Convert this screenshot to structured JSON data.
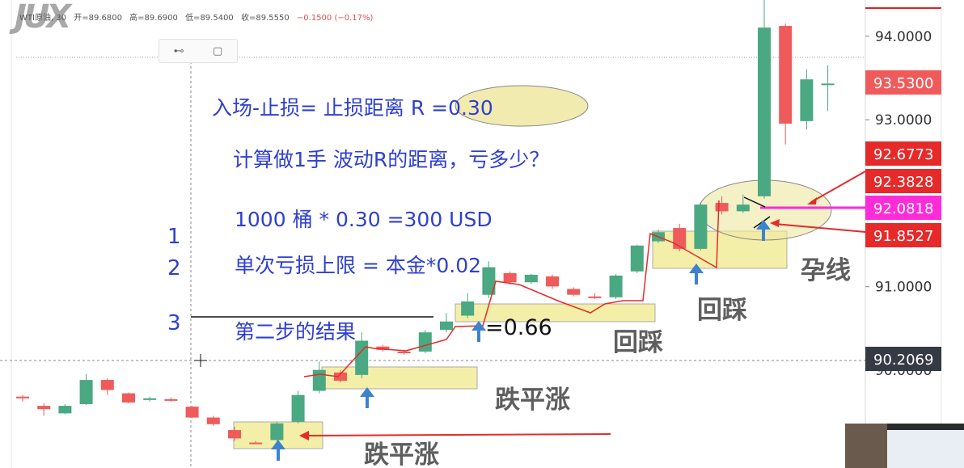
{
  "header": {
    "symbol": "WTI原油, 30",
    "open": "开=89.6800",
    "high": "高=89.6900",
    "low": "低=89.5400",
    "close": "收=89.5550",
    "change": "−0.1500 (−0.17%)"
  },
  "logo_text": "JUX",
  "colors": {
    "up": "#4aa882",
    "down": "#ef5b5b",
    "annot_blue": "#2f3fd0",
    "arrow_red": "#e62a2a",
    "arrow_blue": "#3d82cf",
    "zone_yellow": "#f2ec99",
    "magenta": "#ff2bd8",
    "price_dark": "#363a45"
  },
  "annotations": {
    "line1": "入场-止损= 止损距离 R =0.30",
    "line2": "计算做1手 波动R的距离，亏多少？",
    "line3": "1000 桶 * 0.30 =300 USD",
    "line4": "单次亏损上限 = 本金*0.02",
    "line5": "第二步的结果",
    "num1": "1",
    "num2": "2",
    "num3": "3",
    "ratio": "=0.66",
    "label_a": "跌平涨",
    "label_b": "跌平涨",
    "label_c": "回踩",
    "label_d": "回踩",
    "label_e": "孕线"
  },
  "chart_data": {
    "type": "candlestick",
    "timeframe": "30",
    "ylim": [
      89.6,
      94.8
    ],
    "y_ticks": [
      "94.0000",
      "93.0000",
      "91.0000",
      "90.0000"
    ],
    "price_labels": [
      {
        "value": "93.5300",
        "kind": "last"
      },
      {
        "value": "92.6773",
        "kind": "level"
      },
      {
        "value": "92.3828",
        "kind": "level"
      },
      {
        "value": "92.0818",
        "kind": "entry"
      },
      {
        "value": "91.8527",
        "kind": "level"
      },
      {
        "value": "90.2069",
        "kind": "crosshair"
      }
    ],
    "candles": [
      {
        "o": 89.78,
        "h": 89.8,
        "l": 89.72,
        "c": 89.76
      },
      {
        "o": 89.67,
        "h": 89.7,
        "l": 89.55,
        "c": 89.63
      },
      {
        "o": 89.58,
        "h": 89.69,
        "l": 89.57,
        "c": 89.67
      },
      {
        "o": 89.69,
        "h": 90.05,
        "l": 89.68,
        "c": 89.98
      },
      {
        "o": 89.98,
        "h": 90.0,
        "l": 89.8,
        "c": 89.86
      },
      {
        "o": 89.82,
        "h": 89.83,
        "l": 89.7,
        "c": 89.71
      },
      {
        "o": 89.74,
        "h": 89.78,
        "l": 89.72,
        "c": 89.76
      },
      {
        "o": 89.75,
        "h": 89.77,
        "l": 89.72,
        "c": 89.73
      },
      {
        "o": 89.66,
        "h": 89.67,
        "l": 89.52,
        "c": 89.53
      },
      {
        "o": 89.53,
        "h": 89.55,
        "l": 89.43,
        "c": 89.45
      },
      {
        "o": 89.38,
        "h": 89.42,
        "l": 89.25,
        "c": 89.28
      },
      {
        "o": 89.23,
        "h": 89.25,
        "l": 89.21,
        "c": 89.22
      },
      {
        "o": 89.26,
        "h": 89.48,
        "l": 89.21,
        "c": 89.46
      },
      {
        "o": 89.48,
        "h": 89.85,
        "l": 89.46,
        "c": 89.8
      },
      {
        "o": 89.85,
        "h": 90.2,
        "l": 89.82,
        "c": 90.1
      },
      {
        "o": 90.07,
        "h": 90.1,
        "l": 89.95,
        "c": 89.97
      },
      {
        "o": 90.04,
        "h": 90.55,
        "l": 90.0,
        "c": 90.45
      },
      {
        "o": 90.38,
        "h": 90.4,
        "l": 90.32,
        "c": 90.34
      },
      {
        "o": 90.32,
        "h": 90.34,
        "l": 90.28,
        "c": 90.3
      },
      {
        "o": 90.32,
        "h": 90.58,
        "l": 90.3,
        "c": 90.55
      },
      {
        "o": 90.58,
        "h": 90.78,
        "l": 90.55,
        "c": 90.68
      },
      {
        "o": 90.75,
        "h": 91.02,
        "l": 90.72,
        "c": 90.92
      },
      {
        "o": 91.0,
        "h": 91.4,
        "l": 90.96,
        "c": 91.33
      },
      {
        "o": 91.26,
        "h": 91.28,
        "l": 91.12,
        "c": 91.15
      },
      {
        "o": 91.15,
        "h": 91.25,
        "l": 91.13,
        "c": 91.24
      },
      {
        "o": 91.22,
        "h": 91.24,
        "l": 91.07,
        "c": 91.1
      },
      {
        "o": 91.07,
        "h": 91.09,
        "l": 90.98,
        "c": 91.0
      },
      {
        "o": 90.98,
        "h": 91.02,
        "l": 90.95,
        "c": 90.96
      },
      {
        "o": 90.97,
        "h": 91.25,
        "l": 90.95,
        "c": 91.23
      },
      {
        "o": 91.28,
        "h": 91.6,
        "l": 91.26,
        "c": 91.59
      },
      {
        "o": 91.64,
        "h": 91.78,
        "l": 91.62,
        "c": 91.75
      },
      {
        "o": 91.8,
        "h": 91.85,
        "l": 91.52,
        "c": 91.55
      },
      {
        "o": 91.55,
        "h": 92.1,
        "l": 91.53,
        "c": 92.08
      },
      {
        "o": 92.1,
        "h": 92.18,
        "l": 91.96,
        "c": 92.0
      },
      {
        "o": 92.0,
        "h": 92.2,
        "l": 91.98,
        "c": 92.08
      },
      {
        "o": 92.18,
        "h": 94.6,
        "l": 92.15,
        "c": 94.2
      },
      {
        "o": 94.22,
        "h": 94.25,
        "l": 92.8,
        "c": 93.05
      },
      {
        "o": 93.08,
        "h": 93.7,
        "l": 92.98,
        "c": 93.58
      },
      {
        "o": 93.52,
        "h": 93.75,
        "l": 93.2,
        "c": 93.53
      }
    ]
  }
}
